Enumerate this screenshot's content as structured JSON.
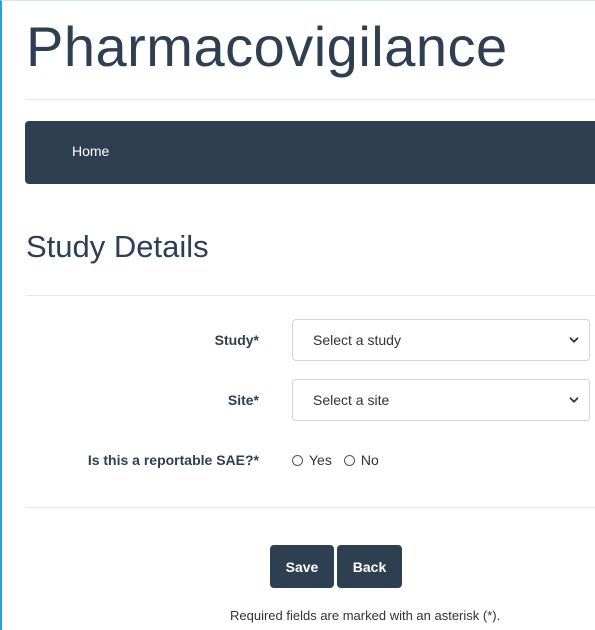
{
  "app": {
    "title": "Pharmacovigilance"
  },
  "nav": {
    "items": [
      {
        "label": "Home"
      }
    ]
  },
  "section": {
    "title": "Study Details"
  },
  "form": {
    "study": {
      "label": "Study*",
      "selected": "Select a study"
    },
    "site": {
      "label": "Site*",
      "selected": "Select a site"
    },
    "reportable_sae": {
      "label": "Is this a reportable SAE?*",
      "options": [
        "Yes",
        "No"
      ]
    }
  },
  "actions": {
    "save_label": "Save",
    "back_label": "Back"
  },
  "footnote": "Required fields are marked with an asterisk (*).",
  "colors": {
    "primary": "#2f3f52",
    "page_border": "#2c9fd6"
  }
}
